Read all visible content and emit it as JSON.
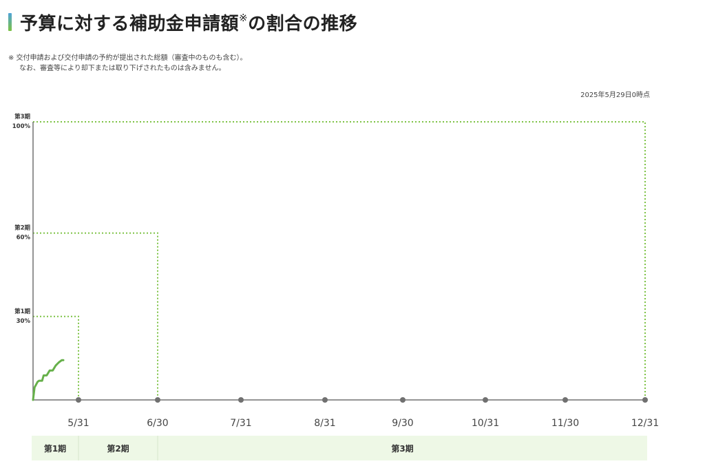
{
  "header": {
    "title_main": "予算に対する補助金申請額",
    "title_mark": "※",
    "title_tail": "の割合の推移"
  },
  "notes": {
    "line1": "※ 交付申請および交付申請の予約が提出された総額（審査中のものも含む）。",
    "line2": "なお、審査等により却下または取り下げされたものは含みません。"
  },
  "timestamp": "2025年5月29日0時点",
  "colors": {
    "accent_green": "#7cc243",
    "series_green": "#66b04a",
    "axis_gray": "#707070",
    "band_bg": "#eef8e6"
  },
  "chart_data": {
    "type": "line",
    "title": "予算に対する補助金申請額※の割合の推移",
    "ylim": [
      0,
      100
    ],
    "x_ticks": [
      "5/31",
      "6/30",
      "7/31",
      "8/31",
      "9/30",
      "10/31",
      "11/30",
      "12/31"
    ],
    "phase_thresholds": [
      {
        "name": "第1期",
        "label": "30%",
        "value": 30,
        "end_date": "5/31"
      },
      {
        "name": "第2期",
        "label": "60%",
        "value": 60,
        "end_date": "6/30"
      },
      {
        "name": "第3期",
        "label": "100%",
        "value": 100,
        "end_date": "12/31"
      }
    ],
    "phase_bands": [
      "第1期",
      "第2期",
      "第3期"
    ],
    "series": [
      {
        "points": [
          [
            "5/1",
            0
          ],
          [
            "5/2",
            4.5
          ],
          [
            "5/3",
            5.5
          ],
          [
            "5/4",
            6.5
          ],
          [
            "5/5",
            6.9
          ],
          [
            "5/7",
            6.9
          ],
          [
            "5/8",
            8.8
          ],
          [
            "5/10",
            8.8
          ],
          [
            "5/12",
            10.6
          ],
          [
            "5/14",
            10.6
          ],
          [
            "5/16",
            12.4
          ],
          [
            "5/18",
            13.5
          ],
          [
            "5/20",
            14.3
          ],
          [
            "5/21",
            14.3
          ]
        ]
      }
    ]
  }
}
